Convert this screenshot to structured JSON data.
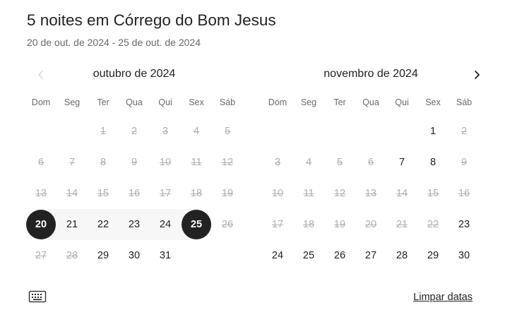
{
  "header": {
    "title": "5 noites em Córrego do Bom Jesus",
    "subtitle": "20 de out. de 2024 - 25 de out. de 2024"
  },
  "weekdays": [
    "Dom",
    "Seg",
    "Ter",
    "Qua",
    "Qui",
    "Sex",
    "Sáb"
  ],
  "months": [
    {
      "title": "outubro de 2024",
      "first_weekday": 2,
      "days": [
        {
          "d": "1",
          "s": "disabled"
        },
        {
          "d": "2",
          "s": "disabled"
        },
        {
          "d": "3",
          "s": "disabled"
        },
        {
          "d": "4",
          "s": "disabled"
        },
        {
          "d": "5",
          "s": "disabled"
        },
        {
          "d": "6",
          "s": "disabled"
        },
        {
          "d": "7",
          "s": "disabled"
        },
        {
          "d": "8",
          "s": "disabled"
        },
        {
          "d": "9",
          "s": "disabled"
        },
        {
          "d": "10",
          "s": "disabled"
        },
        {
          "d": "11",
          "s": "disabled"
        },
        {
          "d": "12",
          "s": "disabled"
        },
        {
          "d": "13",
          "s": "disabled"
        },
        {
          "d": "14",
          "s": "disabled"
        },
        {
          "d": "15",
          "s": "disabled"
        },
        {
          "d": "16",
          "s": "disabled"
        },
        {
          "d": "17",
          "s": "disabled"
        },
        {
          "d": "18",
          "s": "disabled"
        },
        {
          "d": "19",
          "s": "disabled"
        },
        {
          "d": "20",
          "s": "start"
        },
        {
          "d": "21",
          "s": "range"
        },
        {
          "d": "22",
          "s": "range"
        },
        {
          "d": "23",
          "s": "range"
        },
        {
          "d": "24",
          "s": "range"
        },
        {
          "d": "25",
          "s": "end"
        },
        {
          "d": "26",
          "s": "disabled"
        },
        {
          "d": "27",
          "s": "disabled"
        },
        {
          "d": "28",
          "s": "disabled"
        },
        {
          "d": "29",
          "s": "available"
        },
        {
          "d": "30",
          "s": "available"
        },
        {
          "d": "31",
          "s": "available"
        }
      ]
    },
    {
      "title": "novembro de 2024",
      "first_weekday": 5,
      "days": [
        {
          "d": "1",
          "s": "available"
        },
        {
          "d": "2",
          "s": "disabled"
        },
        {
          "d": "3",
          "s": "disabled"
        },
        {
          "d": "4",
          "s": "disabled"
        },
        {
          "d": "5",
          "s": "disabled"
        },
        {
          "d": "6",
          "s": "disabled"
        },
        {
          "d": "7",
          "s": "available"
        },
        {
          "d": "8",
          "s": "available"
        },
        {
          "d": "9",
          "s": "disabled"
        },
        {
          "d": "10",
          "s": "disabled"
        },
        {
          "d": "11",
          "s": "disabled"
        },
        {
          "d": "12",
          "s": "disabled"
        },
        {
          "d": "13",
          "s": "disabled"
        },
        {
          "d": "14",
          "s": "disabled"
        },
        {
          "d": "15",
          "s": "disabled"
        },
        {
          "d": "16",
          "s": "disabled"
        },
        {
          "d": "17",
          "s": "disabled"
        },
        {
          "d": "18",
          "s": "disabled"
        },
        {
          "d": "19",
          "s": "disabled"
        },
        {
          "d": "20",
          "s": "disabled"
        },
        {
          "d": "21",
          "s": "disabled"
        },
        {
          "d": "22",
          "s": "disabled"
        },
        {
          "d": "23",
          "s": "available"
        },
        {
          "d": "24",
          "s": "available"
        },
        {
          "d": "25",
          "s": "available"
        },
        {
          "d": "26",
          "s": "available"
        },
        {
          "d": "27",
          "s": "available"
        },
        {
          "d": "28",
          "s": "available"
        },
        {
          "d": "29",
          "s": "available"
        },
        {
          "d": "30",
          "s": "available"
        }
      ]
    }
  ],
  "nav": {
    "prev_icon": "chevron-left-icon",
    "prev_enabled": false,
    "next_icon": "chevron-right-icon",
    "next_enabled": true
  },
  "footer": {
    "keyboard_icon": "keyboard-icon",
    "clear_label": "Limpar datas"
  },
  "colors": {
    "text": "#222222",
    "muted": "#6a6a6a",
    "disabled": "#b0b0b0",
    "selected_bg": "#222222",
    "range_bg": "#f7f7f7"
  }
}
